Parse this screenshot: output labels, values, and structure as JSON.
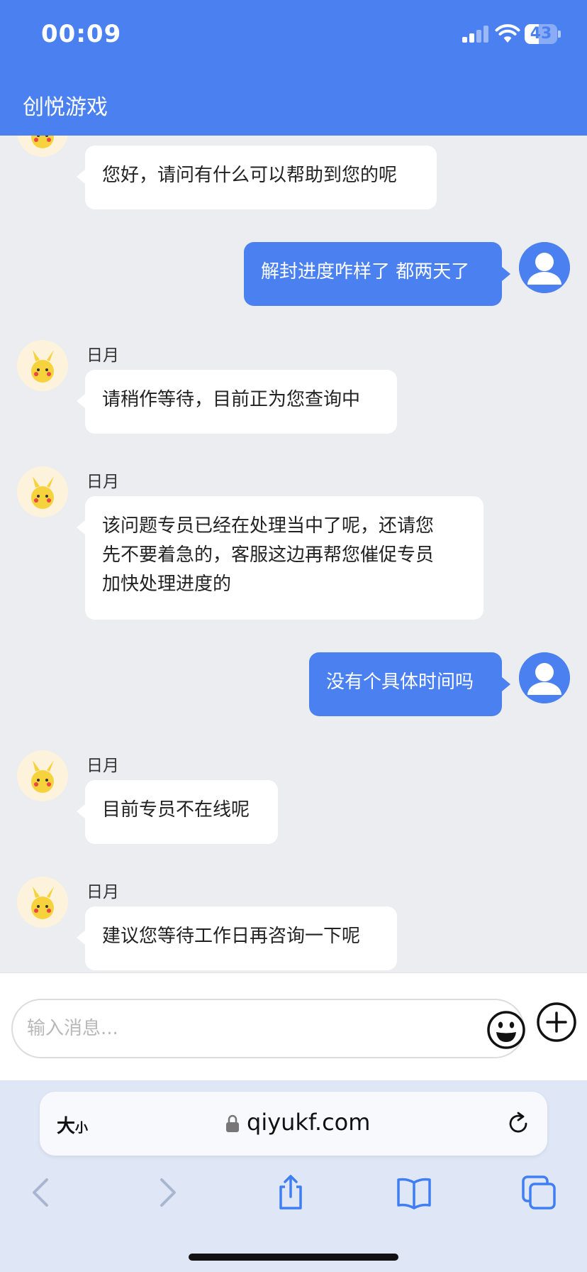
{
  "status_bar": {
    "time": "00:09",
    "battery_level": "43"
  },
  "app": {
    "title": "创悦游戏"
  },
  "messages": [
    {
      "from": "agent",
      "sender": "",
      "text": "您好，请问有什么可以帮助到您的呢"
    },
    {
      "from": "user",
      "text": "解封进度咋样了 都两天了"
    },
    {
      "from": "agent",
      "sender": "日月",
      "text": "请稍作等待，目前正为您查询中"
    },
    {
      "from": "agent",
      "sender": "日月",
      "lines": [
        "该问题专员已经在处理当中了呢，还请您",
        "先不要着急的，客服这边再帮您催促专员",
        "加快处理进度的"
      ]
    },
    {
      "from": "user",
      "text": "没有个具体时间吗"
    },
    {
      "from": "agent",
      "sender": "日月",
      "text": "目前专员不在线呢"
    },
    {
      "from": "agent",
      "sender": "日月",
      "text": "建议您等待工作日再咨询一下呢"
    }
  ],
  "composer": {
    "placeholder": "输入消息..."
  },
  "browser": {
    "text_size_label": "大",
    "text_size_label_small": "小",
    "url": "qiyukf.com"
  },
  "colors": {
    "accent": "#4a80f0",
    "chat_bg": "#ebedf0",
    "safari_bg": "#dfe7f7"
  }
}
